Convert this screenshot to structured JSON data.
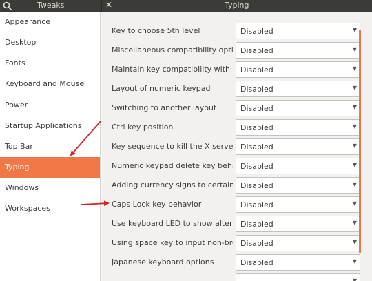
{
  "sidebar_header": {
    "title": "Tweaks",
    "search_icon": "search-icon"
  },
  "main_header": {
    "title": "Typing",
    "close_icon": "close-icon"
  },
  "sidebar": {
    "items": [
      {
        "label": "Appearance"
      },
      {
        "label": "Desktop"
      },
      {
        "label": "Fonts"
      },
      {
        "label": "Keyboard and Mouse"
      },
      {
        "label": "Power"
      },
      {
        "label": "Startup Applications"
      },
      {
        "label": "Top Bar"
      },
      {
        "label": "Typing",
        "selected": true
      },
      {
        "label": "Windows"
      },
      {
        "label": "Workspaces"
      }
    ]
  },
  "settings": [
    {
      "label": "Key to choose 5th level",
      "value": "Disabled"
    },
    {
      "label": "Miscellaneous compatibility opti…",
      "value": "Disabled"
    },
    {
      "label": "Maintain key compatibility with o…",
      "value": "Disabled"
    },
    {
      "label": "Layout of numeric keypad",
      "value": "Disabled"
    },
    {
      "label": "Switching to another layout",
      "value": "Disabled"
    },
    {
      "label": "Ctrl key position",
      "value": "Disabled"
    },
    {
      "label": "Key sequence to kill the X server",
      "value": "Disabled"
    },
    {
      "label": "Numeric keypad delete key behav…",
      "value": "Disabled"
    },
    {
      "label": "Adding currency signs to certain k…",
      "value": "Disabled"
    },
    {
      "label": "Caps Lock key behavior",
      "value": "Disabled"
    },
    {
      "label": "Use keyboard LED to show altern…",
      "value": "Disabled"
    },
    {
      "label": "Using space key to input non-brea…",
      "value": "Disabled"
    },
    {
      "label": "Japanese keyboard options",
      "value": "Disabled"
    }
  ],
  "colors": {
    "accent": "#f07746",
    "header_bg": "#3b3b37",
    "annotation_arrow": "#d0262a"
  }
}
